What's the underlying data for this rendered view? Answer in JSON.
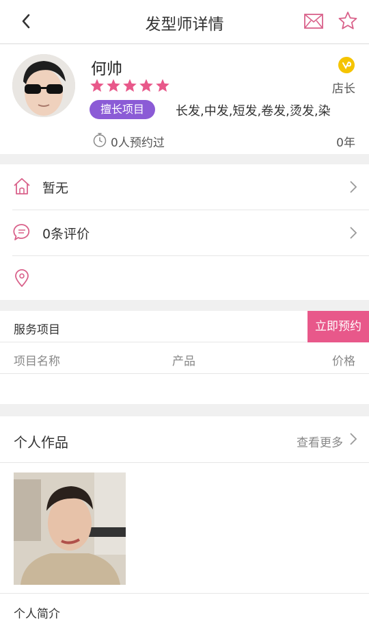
{
  "header": {
    "title": "发型师详情",
    "icons": {
      "back": "chevron-left-icon",
      "mail": "mail-icon",
      "favorite": "star-outline-icon"
    }
  },
  "profile": {
    "name": "何帅",
    "rating": 5,
    "role": "店长",
    "skill_tag": "擅长项目",
    "skills": "长发,中发,短发,卷发,烫发,染",
    "appointments": "0人预约过",
    "years": "0年"
  },
  "info": {
    "address": "暂无",
    "reviews": "0条评价"
  },
  "service": {
    "title": "服务项目",
    "book_label": "立即预约",
    "columns": [
      "项目名称",
      "产品",
      "价格"
    ]
  },
  "works": {
    "title": "个人作品",
    "more_label": "查看更多"
  },
  "intro": {
    "label": "个人简介"
  },
  "colors": {
    "accent": "#e8588a",
    "tag": "#8b5bd6",
    "badge": "#f5c400"
  }
}
